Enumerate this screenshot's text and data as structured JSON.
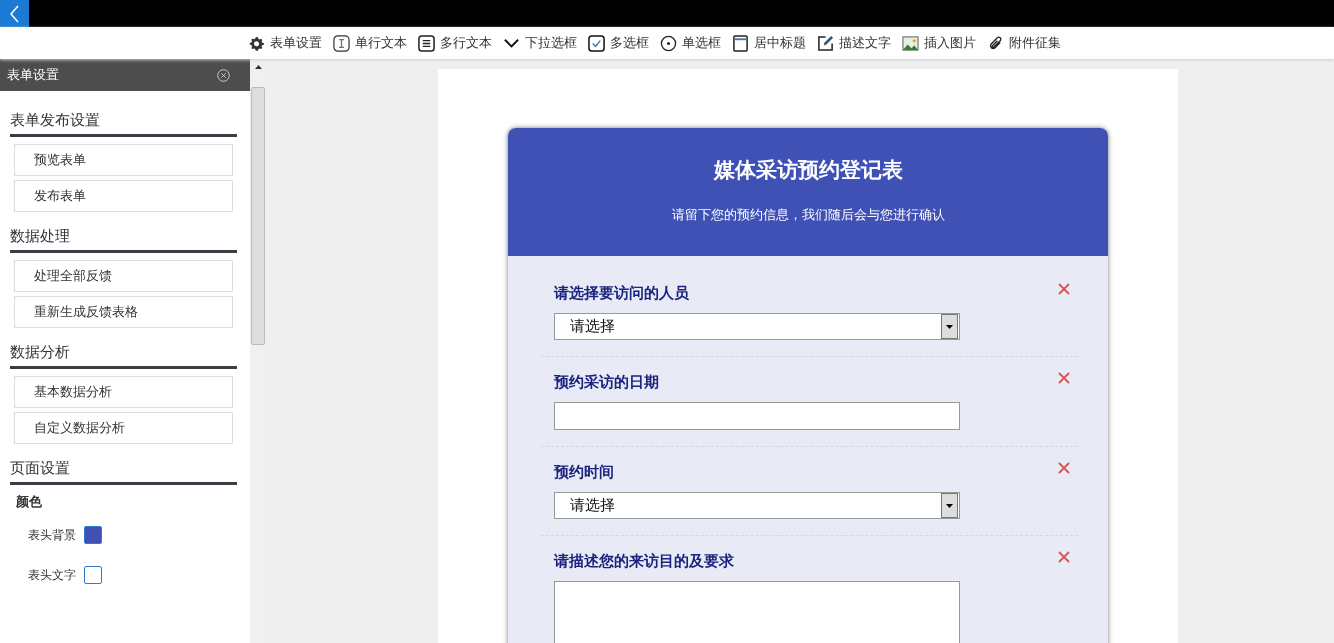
{
  "toolbar": [
    {
      "kind": "gear",
      "label": "表单设置"
    },
    {
      "kind": "textcursor",
      "label": "单行文本"
    },
    {
      "kind": "lines",
      "label": "多行文本"
    },
    {
      "kind": "chevron",
      "label": "下拉选框"
    },
    {
      "kind": "checkbox",
      "label": "多选框"
    },
    {
      "kind": "radio",
      "label": "单选框"
    },
    {
      "kind": "title",
      "label": "居中标题"
    },
    {
      "kind": "pencil",
      "label": "描述文字"
    },
    {
      "kind": "image",
      "label": "插入图片"
    },
    {
      "kind": "paperclip",
      "label": "附件征集"
    }
  ],
  "sidebar": {
    "title": "表单设置",
    "sections": [
      {
        "title": "表单发布设置",
        "buttons": [
          "预览表单",
          "发布表单"
        ]
      },
      {
        "title": "数据处理",
        "buttons": [
          "处理全部反馈",
          "重新生成反馈表格"
        ]
      },
      {
        "title": "数据分析",
        "buttons": [
          "基本数据分析",
          "自定义数据分析"
        ]
      }
    ],
    "page_settings": {
      "title": "页面设置",
      "group": "颜色",
      "colors": [
        {
          "label": "表头背景",
          "color": "#3f51b5"
        },
        {
          "label": "表头文字",
          "color": "#ffffff"
        }
      ]
    }
  },
  "form": {
    "title": "媒体采访预约登记表",
    "subtitle": "请留下您的预约信息，我们随后会与您进行确认",
    "fields": [
      {
        "kind": "select",
        "label": "请选择要访问的人员",
        "value": "请选择"
      },
      {
        "kind": "text",
        "label": "预约采访的日期"
      },
      {
        "kind": "select",
        "label": "预约时间",
        "value": "请选择"
      },
      {
        "kind": "textarea",
        "label": "请描述您的来访目的及要求"
      }
    ]
  }
}
